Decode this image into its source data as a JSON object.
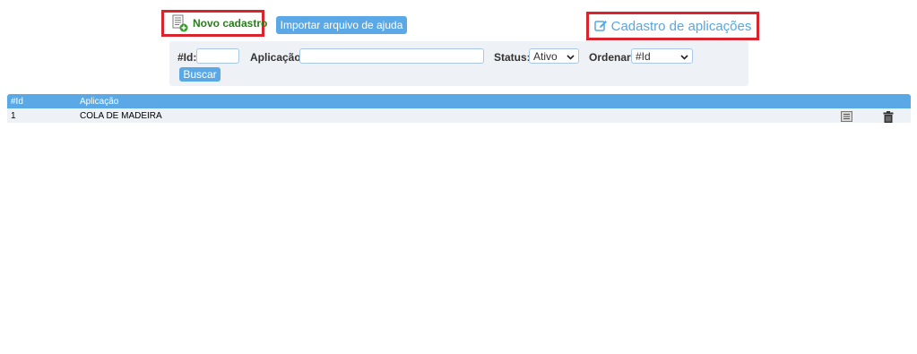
{
  "toolbar": {
    "novo_cadastro_label": "Novo cadastro",
    "importar_label": "Importar arquivo de ajuda"
  },
  "page": {
    "title": "Cadastro de aplicações"
  },
  "filters": {
    "id_label": "#Id:",
    "id_value": "",
    "aplicacao_label": "Aplicação:",
    "aplicacao_value": "",
    "status_label": "Status:",
    "status_value": "Ativo",
    "ordenar_label": "Ordenar:",
    "ordenar_value": "#Id",
    "buscar_label": "Buscar"
  },
  "table": {
    "headers": [
      "#Id",
      "Aplicação"
    ],
    "rows": [
      {
        "id": "1",
        "aplicacao": "COLA DE MADEIRA"
      }
    ]
  },
  "colors": {
    "accent": "#5aa8e6",
    "highlight_border": "#d9232d",
    "novo_text": "#2a7d1c",
    "panel_bg": "#eef1f6"
  }
}
